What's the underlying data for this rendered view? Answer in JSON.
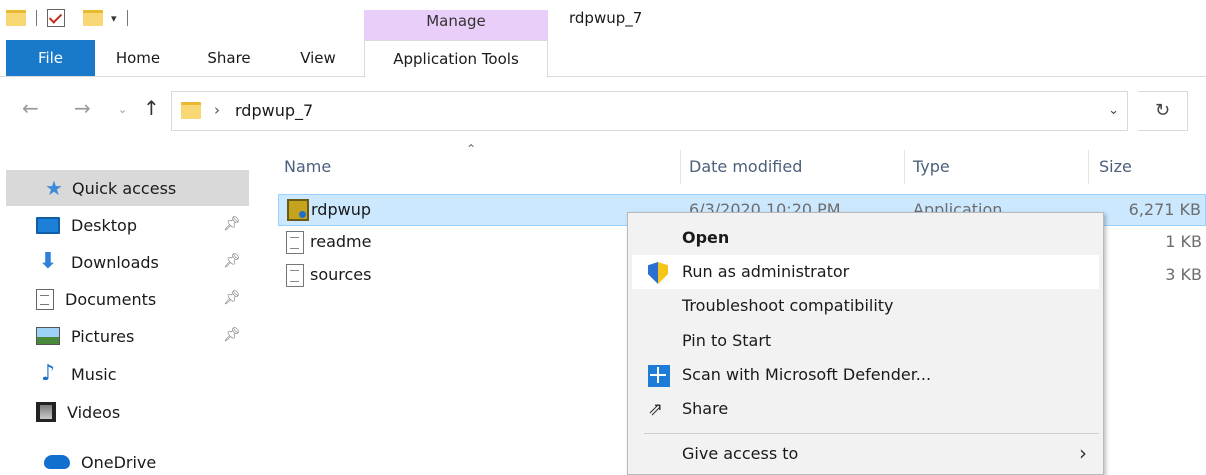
{
  "titlebar": {
    "title": "rdpwup_7",
    "contextual_group": "Manage",
    "dropdown_glyph": "▾"
  },
  "ribbon": {
    "tabs": [
      "File",
      "Home",
      "Share",
      "View",
      "Application Tools"
    ],
    "active_color": "#1979ca"
  },
  "address": {
    "path": "rdpwup_7",
    "chevron": "›"
  },
  "nav_pane": {
    "items": [
      {
        "label": "Quick access",
        "icon": "star-icon",
        "selected": true
      },
      {
        "label": "Desktop",
        "icon": "desktop-icon",
        "pinned": true
      },
      {
        "label": "Downloads",
        "icon": "download-icon",
        "pinned": true
      },
      {
        "label": "Documents",
        "icon": "documents-icon",
        "pinned": true
      },
      {
        "label": "Pictures",
        "icon": "pictures-icon",
        "pinned": true
      },
      {
        "label": "Music",
        "icon": "music-icon"
      },
      {
        "label": "Videos",
        "icon": "videos-icon"
      },
      {
        "label": "OneDrive",
        "icon": "onedrive-icon"
      }
    ]
  },
  "file_list": {
    "columns": [
      "Name",
      "Date modified",
      "Type",
      "Size"
    ],
    "rows": [
      {
        "name": "rdpwup",
        "date": "6/3/2020 10:20 PM",
        "type": "Application",
        "size": "6,271 KB",
        "icon": "application-icon",
        "selected": true
      },
      {
        "name": "readme",
        "date": "",
        "type": "",
        "size": "1 KB",
        "icon": "text-file-icon"
      },
      {
        "name": "sources",
        "date": "",
        "type": "",
        "size": "3 KB",
        "icon": "text-file-icon"
      }
    ]
  },
  "context_menu": {
    "items": [
      {
        "label": "Open",
        "bold": true
      },
      {
        "label": "Run as administrator",
        "icon": "uac-shield-icon",
        "hover": true
      },
      {
        "label": "Troubleshoot compatibility"
      },
      {
        "label": "Pin to Start"
      },
      {
        "label": "Scan with Microsoft Defender...",
        "icon": "defender-icon"
      },
      {
        "label": "Share",
        "icon": "share-icon"
      },
      {
        "label": "Give access to",
        "submenu": true
      }
    ]
  }
}
